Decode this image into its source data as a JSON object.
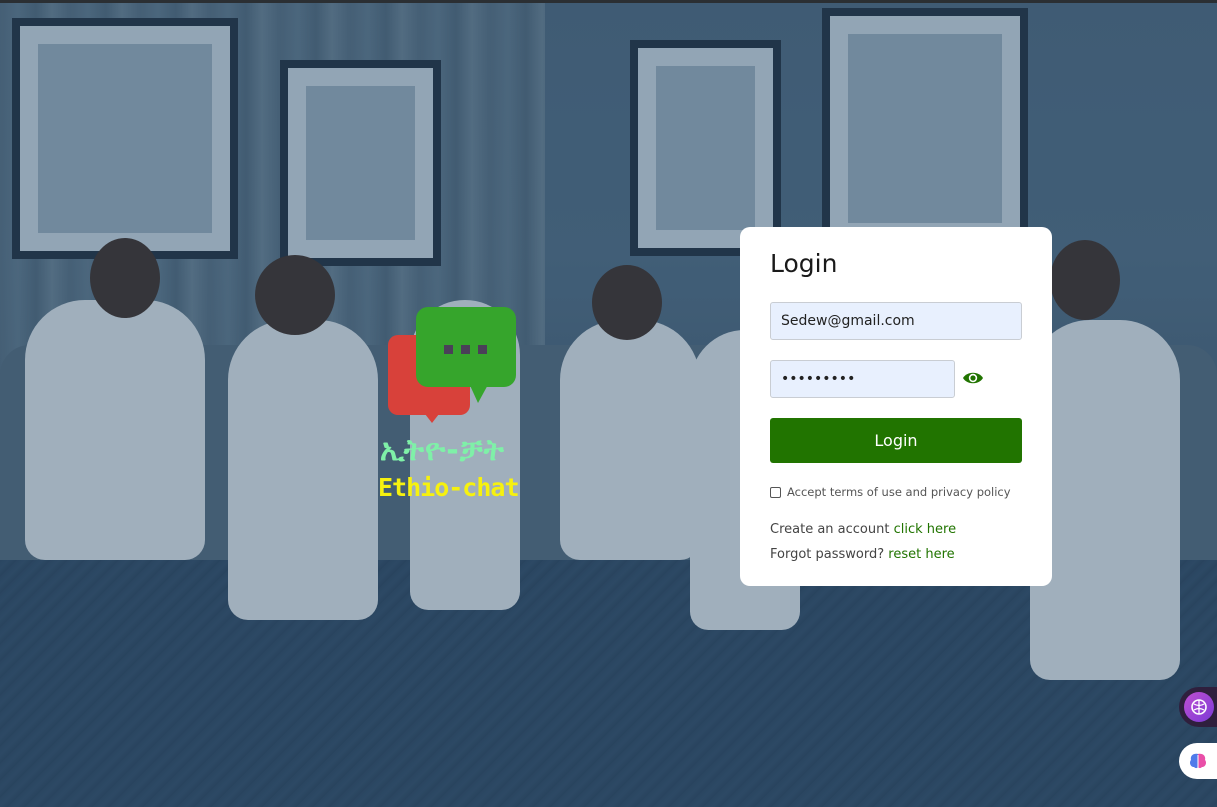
{
  "logo": {
    "amharic": "ኢትዮ-ቻት",
    "latin": "Ethio-chat"
  },
  "login": {
    "title": "Login",
    "email_value": "Sedew@gmail.com",
    "password_value": "•••••••••",
    "button_label": "Login",
    "terms_label": "Accept terms of use and privacy policy",
    "create_text": "Create an account ",
    "create_link": "click here",
    "forgot_text": "Forgot password? ",
    "forgot_link": "reset here"
  },
  "icons": {
    "eye": "eye-icon",
    "brain": "brain-icon"
  },
  "colors": {
    "accent": "#217400",
    "logo_green": "#36a52c",
    "logo_red": "#d8413a",
    "logo_yellow": "#f6f10f",
    "logo_mint": "#7ff0a8"
  }
}
